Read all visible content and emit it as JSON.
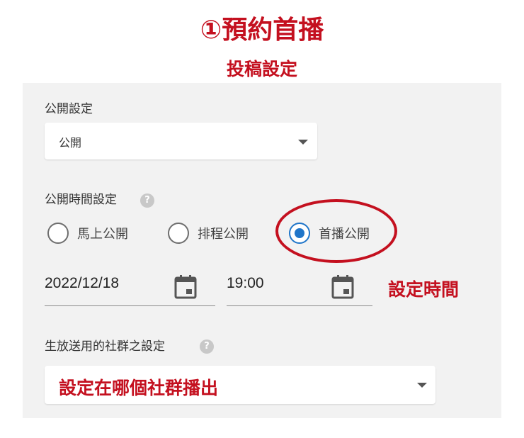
{
  "header": {
    "title": "①預約首播",
    "subtitle": "投稿設定"
  },
  "visibility": {
    "label": "公開設定",
    "selected": "公開"
  },
  "schedule": {
    "label": "公開時間設定",
    "help_icon": "question-icon",
    "options": [
      {
        "label": "馬上公開",
        "checked": false
      },
      {
        "label": "排程公開",
        "checked": false
      },
      {
        "label": "首播公開",
        "checked": true
      }
    ],
    "date_value": "2022/12/18",
    "time_value": "19:00",
    "annotation": "設定時間"
  },
  "social": {
    "label": "生放送用的社群之設定",
    "help_icon": "question-icon",
    "selected": "設定在哪個社群播出"
  },
  "colors": {
    "accent_red": "#c4101f",
    "radio_blue": "#1f75c9",
    "panel_bg": "#f2f2f2"
  }
}
